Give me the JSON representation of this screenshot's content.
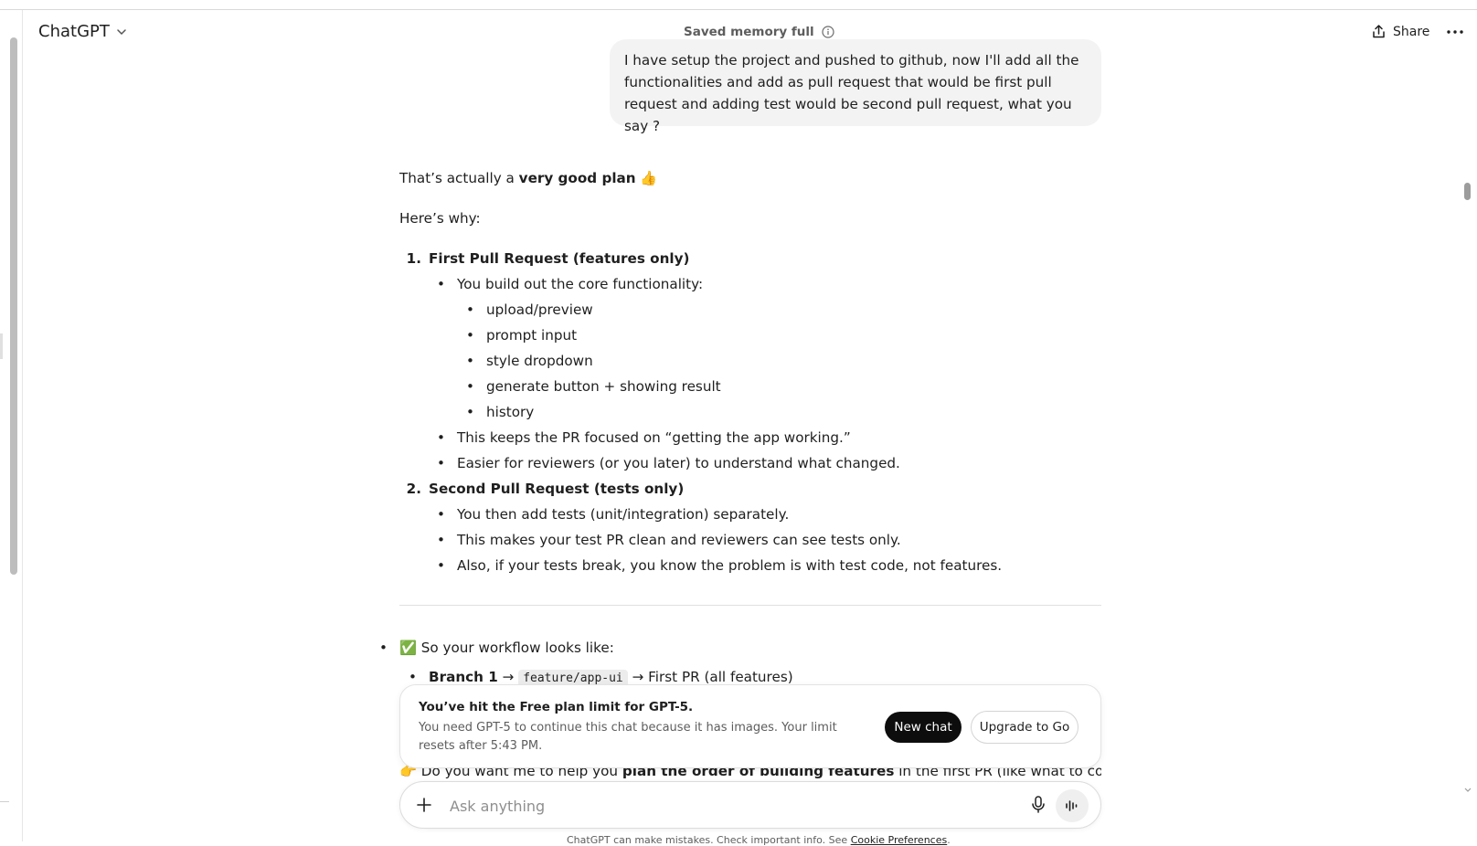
{
  "header": {
    "model_name": "ChatGPT",
    "memory_status": "Saved memory full",
    "share_label": "Share"
  },
  "user_message": "I have setup the project and pushed to github, now I'll add all the functionalities and add as pull request that would be first pull request and adding test would be second pull request, what you say ?",
  "assistant": {
    "intro_prefix": "That’s actually a ",
    "intro_bold": "very good plan",
    "intro_emoji": "👍",
    "why": "Here’s why:",
    "items": [
      {
        "number": "1.",
        "title": "First Pull Request (features only)",
        "bullets": [
          "You build out the core functionality:",
          "This keeps the PR focused on “getting the app working.”",
          "Easier for reviewers (or you later) to understand what changed."
        ],
        "sub_bullets": [
          "upload/preview",
          "prompt input",
          "style dropdown",
          "generate button + showing result",
          "history"
        ]
      },
      {
        "number": "2.",
        "title": "Second Pull Request (tests only)",
        "bullets": [
          "You then add tests (unit/integration) separately.",
          "This makes your test PR clean and reviewers can see tests only.",
          "Also, if your tests break, you know the problem is with test code, not features."
        ]
      }
    ],
    "workflow_emoji": "✅",
    "workflow_title": "So your workflow looks like:",
    "branch_label": "Branch 1",
    "branch_arrow": "→",
    "branch_code": "feature/app-ui",
    "branch_arrow2": "→",
    "branch_result": "First PR (all features)",
    "cutoff_emoji": "👉",
    "cutoff_prefix": "Do you want me to help you ",
    "cutoff_bold": "plan the order of building features",
    "cutoff_suffix": " in the first PR (like what to code first,"
  },
  "limit_notice": {
    "title": "You’ve hit the Free plan limit for GPT-5.",
    "body": "You need GPT-5 to continue this chat because it has images. Your limit resets after 5:43 PM.",
    "new_chat_label": "New chat",
    "upgrade_label": "Upgrade to Go"
  },
  "composer": {
    "placeholder": "Ask anything"
  },
  "footer": {
    "text": "ChatGPT can make mistakes. Check important info. See ",
    "link": "Cookie Preferences",
    "end": "."
  },
  "icons": {
    "model_dropdown": "chevron-down-icon",
    "memory_info": "info-icon",
    "share": "share-icon",
    "more": "more-horizontal-icon",
    "composer_add": "plus-icon",
    "composer_mic": "microphone-icon",
    "composer_voice": "voice-mode-icon"
  }
}
